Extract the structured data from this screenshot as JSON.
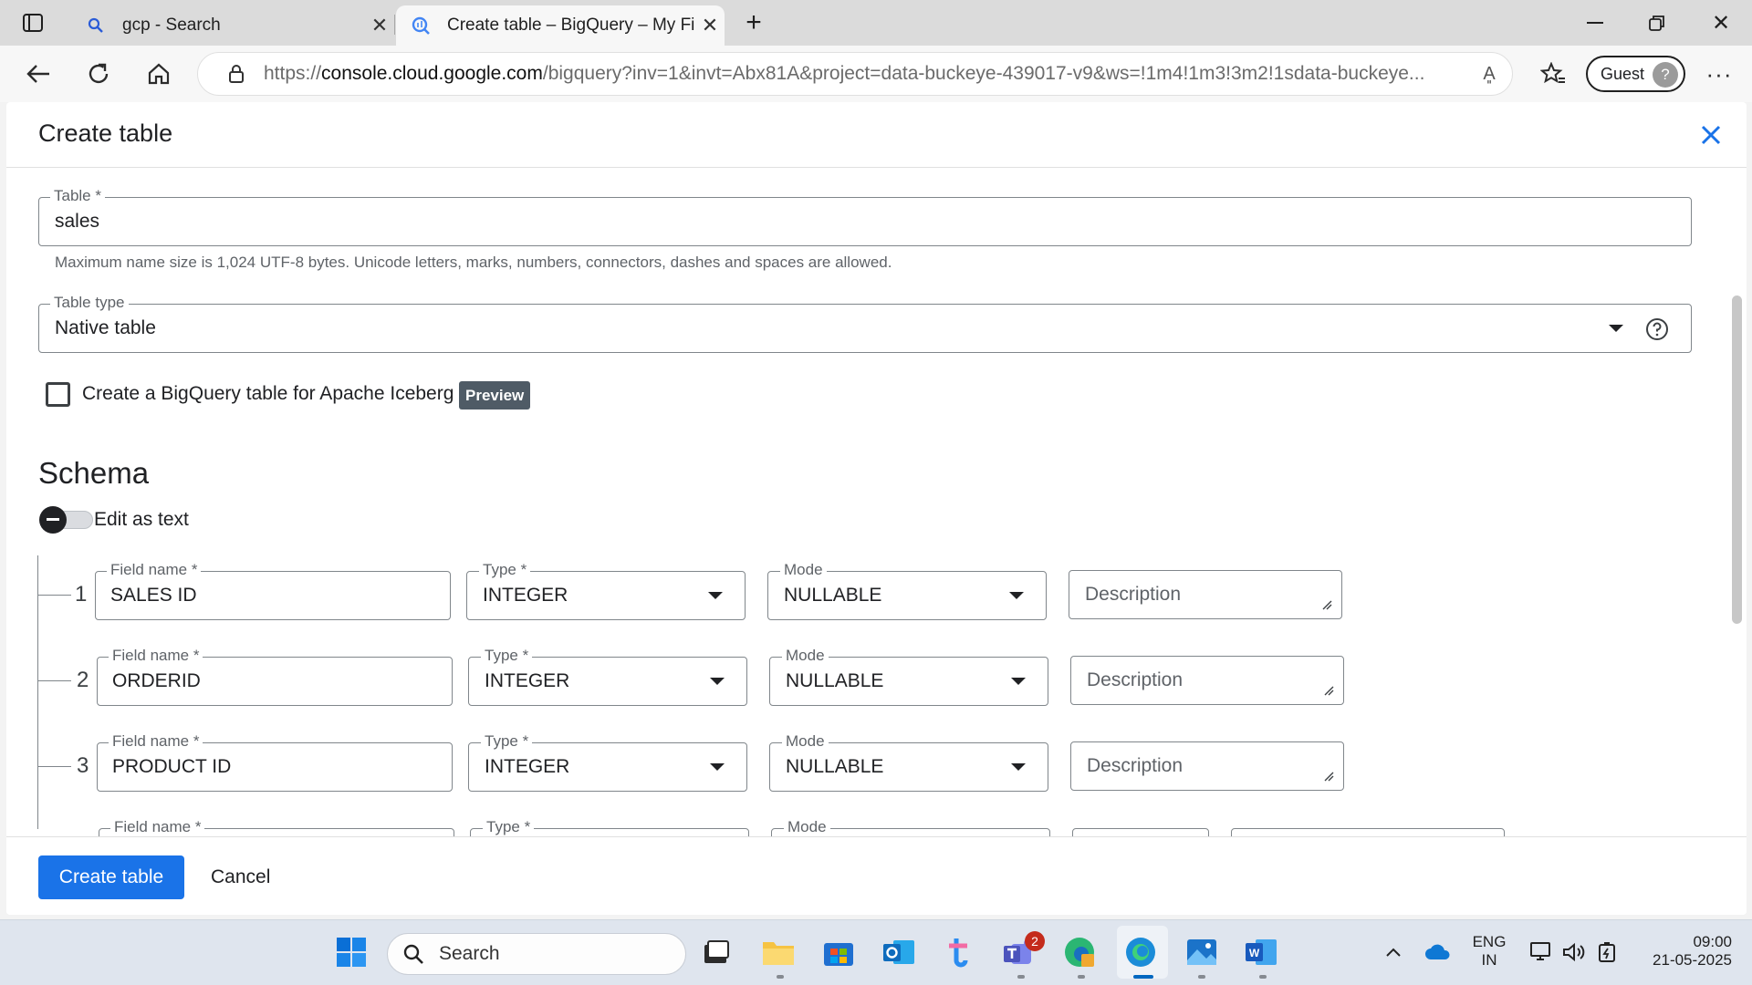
{
  "browser": {
    "tabs": [
      {
        "title": "gcp - Search",
        "active": false
      },
      {
        "title": "Create table – BigQuery – My First Project",
        "active": true
      }
    ],
    "url_prefix": "https://",
    "url_host": "console.cloud.google.com",
    "url_rest": "/bigquery?inv=1&invt=Abx81A&project=data-buckeye-439017-v9&ws=!1m4!1m3!3m2!1sdata-buckeye...",
    "profile_label": "Guest",
    "read_aloud_icon": "A͈"
  },
  "dialog": {
    "title": "Create table",
    "table_field": {
      "label": "Table *",
      "value": "sales",
      "hint": "Maximum name size is 1,024 UTF-8 bytes. Unicode letters, marks, numbers, connectors, dashes and spaces are allowed."
    },
    "table_type": {
      "label": "Table type",
      "value": "Native table"
    },
    "iceberg_checkbox": {
      "label": "Create a BigQuery table for Apache Iceberg",
      "checked": false,
      "badge": "Preview"
    },
    "schema": {
      "title": "Schema",
      "edit_as_text_label": "Edit as text",
      "rows": [
        {
          "num": "1",
          "field_name_label": "Field name *",
          "field_name": "SALES ID",
          "type_label": "Type *",
          "type": "INTEGER",
          "mode_label": "Mode",
          "mode": "NULLABLE",
          "description_placeholder": "Description"
        },
        {
          "num": "2",
          "field_name_label": "Field name *",
          "field_name": "ORDERID",
          "type_label": "Type *",
          "type": "INTEGER",
          "mode_label": "Mode",
          "mode": "NULLABLE",
          "description_placeholder": "Description"
        },
        {
          "num": "3",
          "field_name_label": "Field name *",
          "field_name": "PRODUCT ID",
          "type_label": "Type *",
          "type": "INTEGER",
          "mode_label": "Mode",
          "mode": "NULLABLE",
          "description_placeholder": "Description"
        },
        {
          "field_name_label": "Field name *",
          "type_label": "Type *",
          "mode_label": "Mode"
        }
      ]
    },
    "buttons": {
      "create": "Create table",
      "cancel": "Cancel"
    }
  },
  "taskbar": {
    "search_label": "Search",
    "teams_badge": "2",
    "language_line1": "ENG",
    "language_line2": "IN",
    "time": "09:00",
    "date": "21-05-2025"
  },
  "colors": {
    "primary_button": "#1a73e8",
    "badge": "#4f5b66",
    "close_icon": "#1a73e8"
  }
}
